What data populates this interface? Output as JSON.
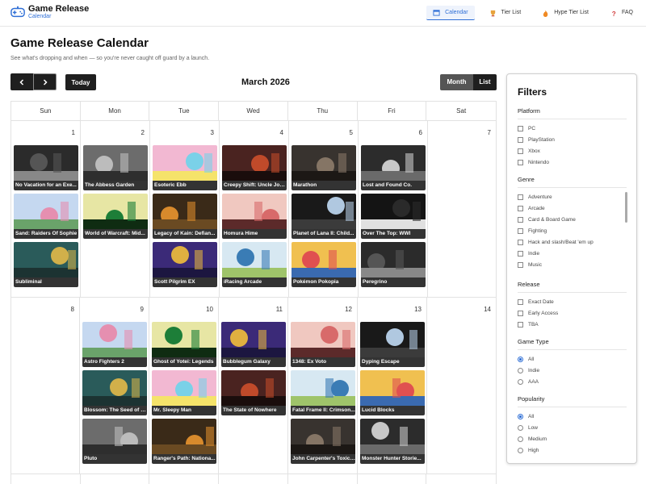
{
  "header": {
    "brand_title": "Game Release",
    "brand_sub": "Calendar",
    "nav": [
      {
        "label": "Calendar",
        "icon": "calendar-icon",
        "active": true
      },
      {
        "label": "Tier List",
        "icon": "trophy-icon",
        "active": false
      },
      {
        "label": "Hype Tier List",
        "icon": "flame-icon",
        "active": false
      },
      {
        "label": "FAQ",
        "icon": "question-icon",
        "active": false
      }
    ]
  },
  "page": {
    "title": "Game Release Calendar",
    "subtitle": "See what's dropping and when — so you're never caught off guard by a launch."
  },
  "controls": {
    "prev_icon": "chevron-left-icon",
    "next_icon": "chevron-right-icon",
    "today": "Today",
    "month": "March 2026",
    "view_month": "Month",
    "view_list": "List"
  },
  "calendar": {
    "days_of_week": [
      "Sun",
      "Mon",
      "Tue",
      "Wed",
      "Thu",
      "Fri",
      "Sat"
    ],
    "weeks": [
      {
        "days": [
          {
            "num": "1",
            "games": [
              "No Vacation for an Exe...",
              "Sand: Raiders Of Sophie",
              "Subliminal"
            ]
          },
          {
            "num": "2",
            "games": [
              "The Abbess Garden",
              "World of Warcraft: Mid..."
            ]
          },
          {
            "num": "3",
            "games": [
              "Esoteric Ebb",
              "Legacy of Kain: Defian...",
              "Scott Pilgrim EX"
            ]
          },
          {
            "num": "4",
            "games": [
              "Creepy Shift: Uncle Joe...",
              "Homura Hime",
              "iRacing Arcade"
            ]
          },
          {
            "num": "5",
            "games": [
              "Marathon",
              "Planet of Lana II: Child...",
              "Pokémon Pokopia"
            ]
          },
          {
            "num": "6",
            "games": [
              "Lost and Found Co.",
              "Over The Top: WWI",
              "Peregrino"
            ]
          },
          {
            "num": "7",
            "games": []
          }
        ]
      },
      {
        "days": [
          {
            "num": "8",
            "games": []
          },
          {
            "num": "9",
            "games": [
              "Astro Fighters 2",
              "Blossom: The Seed of L...",
              "Pluto"
            ]
          },
          {
            "num": "10",
            "games": [
              "Ghost of Yotei: Legends",
              "Mr. Sleepy Man",
              "Ranger's Path: Nationa..."
            ]
          },
          {
            "num": "11",
            "games": [
              "Bubblegum Galaxy",
              "The State of Nowhere"
            ]
          },
          {
            "num": "12",
            "games": [
              "1348: Ex Voto",
              "Fatal Frame II: Crimson...",
              "John Carpenter's Toxic ..."
            ]
          },
          {
            "num": "13",
            "games": [
              "Dyping Escape",
              "Lucid Blocks",
              "Monster Hunter Storie..."
            ]
          },
          {
            "num": "14",
            "games": []
          }
        ]
      }
    ]
  },
  "filters": {
    "title": "Filters",
    "platform": {
      "heading": "Platform",
      "options": [
        "PC",
        "PlayStation",
        "Xbox",
        "Nintendo"
      ]
    },
    "genre": {
      "heading": "Genre",
      "options": [
        "Adventure",
        "Arcade",
        "Card & Board Game",
        "Fighting",
        "Hack and slash/Beat 'em up",
        "Indie",
        "Music"
      ]
    },
    "release": {
      "heading": "Release",
      "options": [
        "Exact Date",
        "Early Access",
        "TBA"
      ]
    },
    "game_type": {
      "heading": "Game Type",
      "options": [
        "All",
        "Indie",
        "AAA"
      ],
      "selected": "All"
    },
    "popularity": {
      "heading": "Popularity",
      "options": [
        "All",
        "Low",
        "Medium",
        "High"
      ],
      "selected": "All"
    }
  },
  "colors": {
    "accent": "#2f6fd6",
    "dark_button": "#1f1f1f",
    "card_label": "#333333"
  }
}
